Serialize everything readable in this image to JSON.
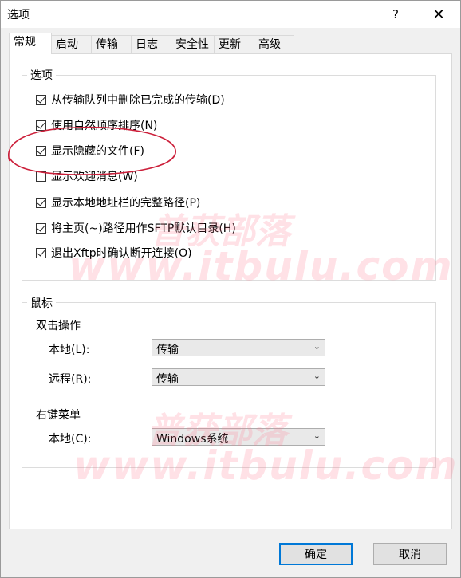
{
  "window": {
    "title": "选项",
    "help": "?",
    "close": "✕"
  },
  "tabs": [
    {
      "label": "常规",
      "active": true
    },
    {
      "label": "启动",
      "active": false
    },
    {
      "label": "传输",
      "active": false
    },
    {
      "label": "日志",
      "active": false
    },
    {
      "label": "安全性",
      "active": false
    },
    {
      "label": "更新",
      "active": false
    },
    {
      "label": "高级",
      "active": false
    }
  ],
  "options_group": {
    "title": "选项",
    "items": [
      {
        "label": "从传输队列中删除已完成的传输(D)",
        "checked": true
      },
      {
        "label": "使用自然顺序排序(N)",
        "checked": true
      },
      {
        "label": "显示隐藏的文件(F)",
        "checked": true
      },
      {
        "label": "显示欢迎消息(W)",
        "checked": false
      },
      {
        "label": "显示本地地址栏的完整路径(P)",
        "checked": true
      },
      {
        "label": "将主页(~)路径用作SFTP默认目录(H)",
        "checked": true
      },
      {
        "label": "退出Xftp时确认断开连接(O)",
        "checked": true
      }
    ]
  },
  "mouse_group": {
    "title": "鼠标",
    "double_click": {
      "title": "双击操作",
      "local_label": "本地(L):",
      "local_value": "传输",
      "remote_label": "远程(R):",
      "remote_value": "传输"
    },
    "context_menu": {
      "title": "右键菜单",
      "local_label": "本地(C):",
      "local_value": "Windows系统"
    }
  },
  "buttons": {
    "ok": "确定",
    "cancel": "取消"
  },
  "watermark": {
    "cn": "普获部落",
    "url": "www.itbulu.com"
  },
  "colors": {
    "accent": "#0078d7",
    "annotation": "#cc1f3a"
  }
}
